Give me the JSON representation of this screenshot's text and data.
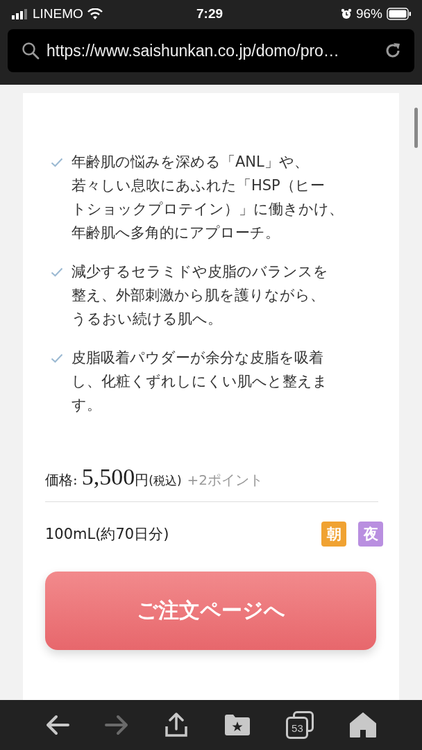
{
  "status_bar": {
    "carrier": "LINEMO",
    "time": "7:29",
    "battery": "96%"
  },
  "address_bar": {
    "url": "https://www.saishunkan.co.jp/domo/pro…"
  },
  "features": [
    {
      "lines": [
        "年齢肌の悩みを深める「ANL」や、",
        "若々しい息吹にあふれた「HSP（ヒー",
        "トショックプロテイン）」に働きかけ、",
        "年齢肌へ多角的にアプローチ。"
      ]
    },
    {
      "lines": [
        "減少するセラミドや皮脂のバランスを",
        "整え、外部刺激から肌を護りながら、",
        "うるおい続ける肌へ。"
      ]
    },
    {
      "lines": [
        "皮脂吸着パウダーが余分な皮脂を吸着",
        "し、化粧くずれしにくい肌へと整えま",
        "す。"
      ]
    }
  ],
  "price": {
    "label": "価格:",
    "amount": "5,500",
    "currency": "円",
    "tax": "(税込)",
    "points": "+2ポイント"
  },
  "volume": "100mL(約70日分)",
  "badges": [
    {
      "label": "朝",
      "color": "#f0a232"
    },
    {
      "label": "夜",
      "color": "#b98fe0"
    }
  ],
  "order_button": "ご注文ページへ",
  "toolbar": {
    "back_disabled": false,
    "forward_disabled": true,
    "tab_count": "53"
  }
}
